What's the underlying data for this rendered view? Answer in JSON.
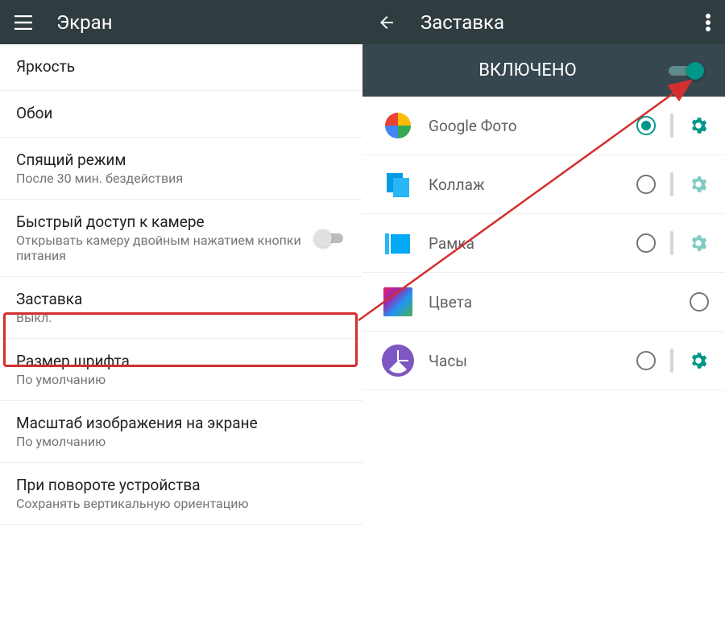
{
  "left": {
    "title": "Экран",
    "items": [
      {
        "title": "Яркость",
        "sub": ""
      },
      {
        "title": "Обои",
        "sub": ""
      },
      {
        "title": "Спящий режим",
        "sub": "После 30 мин. бездействия"
      },
      {
        "title": "Быстрый доступ к камере",
        "sub": "Открывать камеру двойным нажатием кнопки питания",
        "toggle": true,
        "toggle_on": false
      },
      {
        "title": "Заставка",
        "sub": "Выкл."
      },
      {
        "title": "Размер шрифта",
        "sub": "По умолчанию"
      },
      {
        "title": "Масштаб изображения на экране",
        "sub": "По умолчанию"
      },
      {
        "title": "При повороте устройства",
        "sub": "Сохранять вертикальную ориентацию"
      }
    ]
  },
  "right": {
    "title": "Заставка",
    "status_label": "ВКЛЮЧЕНО",
    "status_on": true,
    "options": [
      {
        "label": "Google Фото",
        "selected": true,
        "has_gear": true,
        "gear_muted": false
      },
      {
        "label": "Коллаж",
        "selected": false,
        "has_gear": true,
        "gear_muted": true
      },
      {
        "label": "Рамка",
        "selected": false,
        "has_gear": true,
        "gear_muted": true
      },
      {
        "label": "Цвета",
        "selected": false,
        "has_gear": false
      },
      {
        "label": "Часы",
        "selected": false,
        "has_gear": true,
        "gear_muted": false
      }
    ]
  },
  "colors": {
    "teal": "#009688",
    "teal_muted": "#80cbc4",
    "appbar": "#2f3c40"
  }
}
